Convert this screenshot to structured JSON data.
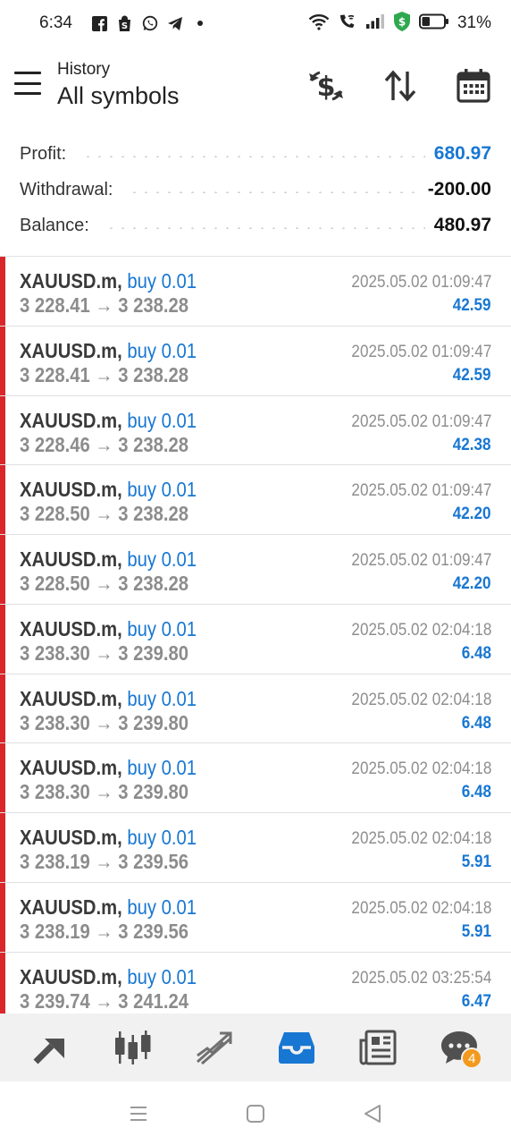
{
  "status_bar": {
    "time": "6:34",
    "battery": "31%",
    "left_icons": [
      "facebook-icon",
      "shopping-bag-icon",
      "whatsapp-icon",
      "telegram-icon",
      "dot-icon"
    ],
    "right_icons": [
      "wifi-icon",
      "wifi-call-icon",
      "signal-icon",
      "shield-dollar-icon",
      "battery-icon"
    ]
  },
  "header": {
    "title": "History",
    "subtitle": "All symbols",
    "actions": [
      "currency-exchange-icon",
      "sort-icon",
      "calendar-icon"
    ]
  },
  "summary": {
    "profit_label": "Profit:",
    "profit_value": "680.97",
    "withdrawal_label": "Withdrawal:",
    "withdrawal_value": "-200.00",
    "balance_label": "Balance:",
    "balance_value": "480.97"
  },
  "trades": [
    {
      "symbol": "XAUUSD.m,",
      "action": "buy 0.01",
      "open": "3 228.41",
      "close": "3 238.28",
      "time": "2025.05.02 01:09:47",
      "profit": "42.59"
    },
    {
      "symbol": "XAUUSD.m,",
      "action": "buy 0.01",
      "open": "3 228.41",
      "close": "3 238.28",
      "time": "2025.05.02 01:09:47",
      "profit": "42.59"
    },
    {
      "symbol": "XAUUSD.m,",
      "action": "buy 0.01",
      "open": "3 228.46",
      "close": "3 238.28",
      "time": "2025.05.02 01:09:47",
      "profit": "42.38"
    },
    {
      "symbol": "XAUUSD.m,",
      "action": "buy 0.01",
      "open": "3 228.50",
      "close": "3 238.28",
      "time": "2025.05.02 01:09:47",
      "profit": "42.20"
    },
    {
      "symbol": "XAUUSD.m,",
      "action": "buy 0.01",
      "open": "3 228.50",
      "close": "3 238.28",
      "time": "2025.05.02 01:09:47",
      "profit": "42.20"
    },
    {
      "symbol": "XAUUSD.m,",
      "action": "buy 0.01",
      "open": "3 238.30",
      "close": "3 239.80",
      "time": "2025.05.02 02:04:18",
      "profit": "6.48"
    },
    {
      "symbol": "XAUUSD.m,",
      "action": "buy 0.01",
      "open": "3 238.30",
      "close": "3 239.80",
      "time": "2025.05.02 02:04:18",
      "profit": "6.48"
    },
    {
      "symbol": "XAUUSD.m,",
      "action": "buy 0.01",
      "open": "3 238.30",
      "close": "3 239.80",
      "time": "2025.05.02 02:04:18",
      "profit": "6.48"
    },
    {
      "symbol": "XAUUSD.m,",
      "action": "buy 0.01",
      "open": "3 238.19",
      "close": "3 239.56",
      "time": "2025.05.02 02:04:18",
      "profit": "5.91"
    },
    {
      "symbol": "XAUUSD.m,",
      "action": "buy 0.01",
      "open": "3 238.19",
      "close": "3 239.56",
      "time": "2025.05.02 02:04:18",
      "profit": "5.91"
    },
    {
      "symbol": "XAUUSD.m,",
      "action": "buy 0.01",
      "open": "3 239.74",
      "close": "3 241.24",
      "time": "2025.05.02 03:25:54",
      "profit": "6.47"
    }
  ],
  "arrow": "→",
  "bottom_nav": {
    "items": [
      "quotes-icon",
      "chart-candles-icon",
      "trade-icon",
      "history-inbox-icon",
      "news-icon",
      "chat-icon"
    ],
    "active": "history-inbox-icon",
    "chat_badge": "4"
  },
  "colors": {
    "accent": "#1877d2",
    "loss_bar": "#d9262b",
    "badge": "#f39a1e"
  }
}
